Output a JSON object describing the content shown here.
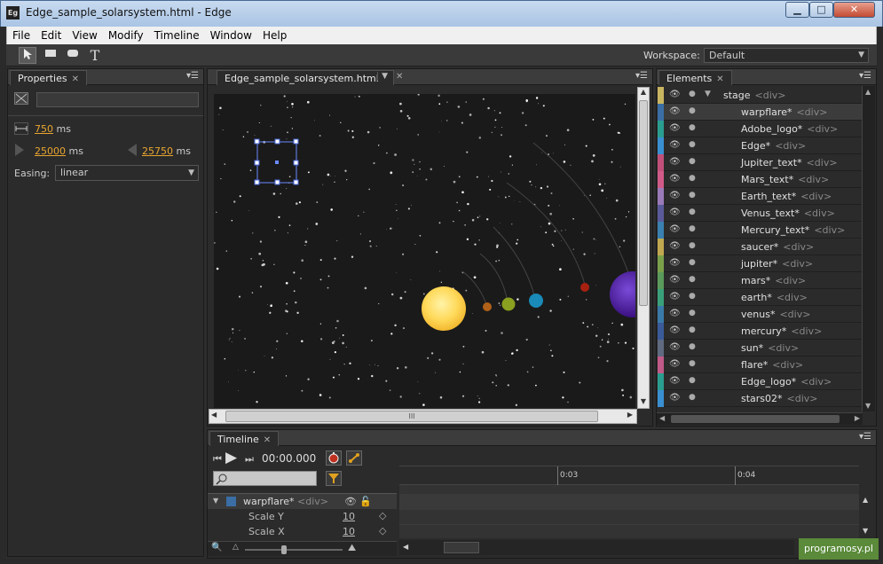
{
  "window": {
    "title": "Edge_sample_solarsystem.html - Edge",
    "app_icon": "Eg",
    "min": "▁",
    "max": "□",
    "close": "✕"
  },
  "menu": [
    "File",
    "Edit",
    "View",
    "Modify",
    "Timeline",
    "Window",
    "Help"
  ],
  "toolbar": {
    "workspace_label": "Workspace:",
    "workspace_value": "Default",
    "text_tool": "T"
  },
  "properties": {
    "tab": "Properties",
    "duration_value": "750",
    "duration_unit": "ms",
    "start_value": "25000",
    "start_unit": "ms",
    "end_value": "25750",
    "end_unit": "ms",
    "easing_label": "Easing:",
    "easing_value": "linear"
  },
  "stage": {
    "tab": "Edge_sample_solarsystem.html",
    "hscroll_grip": "III"
  },
  "elements": {
    "tab": "Elements",
    "items": [
      {
        "name": "stage",
        "tag": "<div>",
        "color": "#c8b560",
        "root": true
      },
      {
        "name": "warpflare*",
        "tag": "<div>",
        "color": "#3a6ea5"
      },
      {
        "name": "Adobe_logo*",
        "tag": "<div>",
        "color": "#2a9d8f"
      },
      {
        "name": "Edge*",
        "tag": "<div>",
        "color": "#3a8fd0"
      },
      {
        "name": "Jupiter_text*",
        "tag": "<div>",
        "color": "#c0507a"
      },
      {
        "name": "Mars_text*",
        "tag": "<div>",
        "color": "#d05a88"
      },
      {
        "name": "Earth_text*",
        "tag": "<div>",
        "color": "#9a7ab8"
      },
      {
        "name": "Venus_text*",
        "tag": "<div>",
        "color": "#5a5a9a"
      },
      {
        "name": "Mercury_text*",
        "tag": "<div>",
        "color": "#3a80b0"
      },
      {
        "name": "saucer*",
        "tag": "<div>",
        "color": "#c0a850"
      },
      {
        "name": "jupiter*",
        "tag": "<div>",
        "color": "#7aa04a"
      },
      {
        "name": "mars*",
        "tag": "<div>",
        "color": "#5a9a5a"
      },
      {
        "name": "earth*",
        "tag": "<div>",
        "color": "#3aa07a"
      },
      {
        "name": "venus*",
        "tag": "<div>",
        "color": "#3a7aa8"
      },
      {
        "name": "mercury*",
        "tag": "<div>",
        "color": "#3a5a9a"
      },
      {
        "name": "sun*",
        "tag": "<div>",
        "color": "#606a80"
      },
      {
        "name": "flare*",
        "tag": "<div>",
        "color": "#c05a88"
      },
      {
        "name": "Edge_logo*",
        "tag": "<div>",
        "color": "#2a9d8f"
      },
      {
        "name": "stars02*",
        "tag": "<div>",
        "color": "#3a8fd0"
      }
    ]
  },
  "timeline": {
    "tab": "Timeline",
    "time": "00:00.000",
    "marker_3": "0:03",
    "marker_4": "0:04",
    "element_name": "warpflare*",
    "element_tag": "<div>",
    "props": [
      {
        "label": "Scale Y",
        "value": "10"
      },
      {
        "label": "Scale X",
        "value": "10"
      }
    ]
  },
  "watermark": "programosy.pl"
}
